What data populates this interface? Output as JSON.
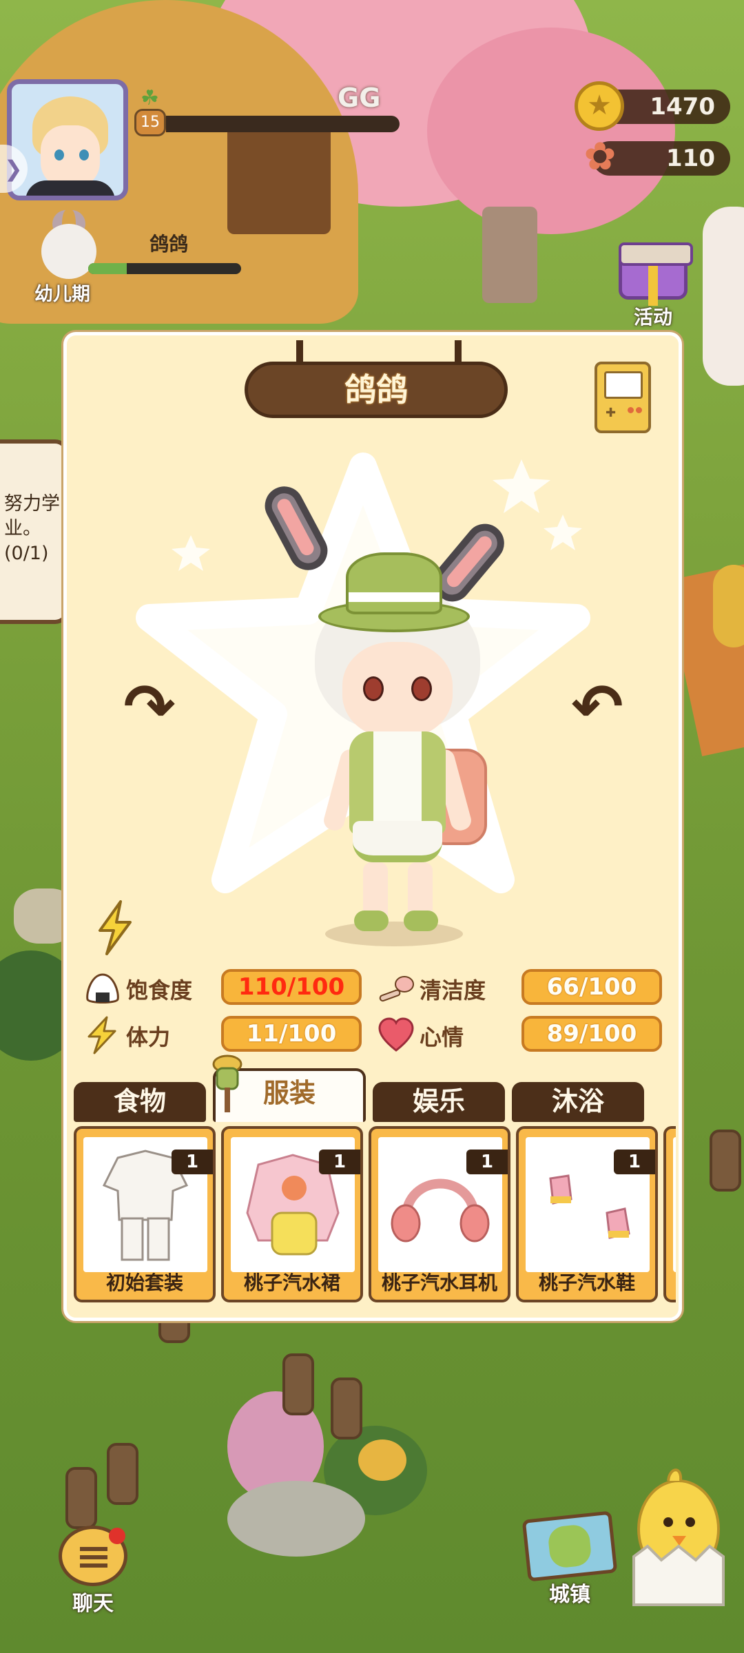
{
  "hud": {
    "player_name": "GG",
    "player_level": "15",
    "xp_progress": 0.12,
    "coins": "1470",
    "flowers": "110",
    "pet_stage": "幼儿期",
    "pet_name": "鸽鸽",
    "pet_progress": 0.25,
    "activity_label": "活动",
    "quest_text": "努力学业。(0/1)"
  },
  "panel": {
    "title": "鸽鸽",
    "stats": {
      "satiety_label": "饱食度",
      "satiety_value": "110/100",
      "cleanliness_label": "清洁度",
      "cleanliness_value": "66/100",
      "stamina_label": "体力",
      "stamina_value": "11/100",
      "mood_label": "心情",
      "mood_value": "89/100"
    },
    "tabs": [
      {
        "label": "食物",
        "active": false
      },
      {
        "label": "服装",
        "active": true
      },
      {
        "label": "娱乐",
        "active": false
      },
      {
        "label": "沐浴",
        "active": false
      }
    ],
    "items": [
      {
        "name": "初始套装",
        "count": "1"
      },
      {
        "name": "桃子汽水裙",
        "count": "1"
      },
      {
        "name": "桃子汽水耳机",
        "count": "1"
      },
      {
        "name": "桃子汽水鞋",
        "count": "1"
      }
    ]
  },
  "bottom": {
    "chat_label": "聊天",
    "town_label": "城镇"
  },
  "colors": {
    "panel_bg": "#fef0c6",
    "tab_dark": "#4c2f19",
    "stat_badge": "#f8b53b",
    "alert_text": "#ff2a10"
  },
  "icons": [
    "coin-icon",
    "flower-icon",
    "gift-icon",
    "gameboy-icon",
    "rotate-left-icon",
    "rotate-right-icon",
    "rice-ball-icon",
    "brush-icon",
    "lightning-icon",
    "heart-icon",
    "chat-icon",
    "map-icon",
    "chick-icon",
    "sprout-icon"
  ]
}
